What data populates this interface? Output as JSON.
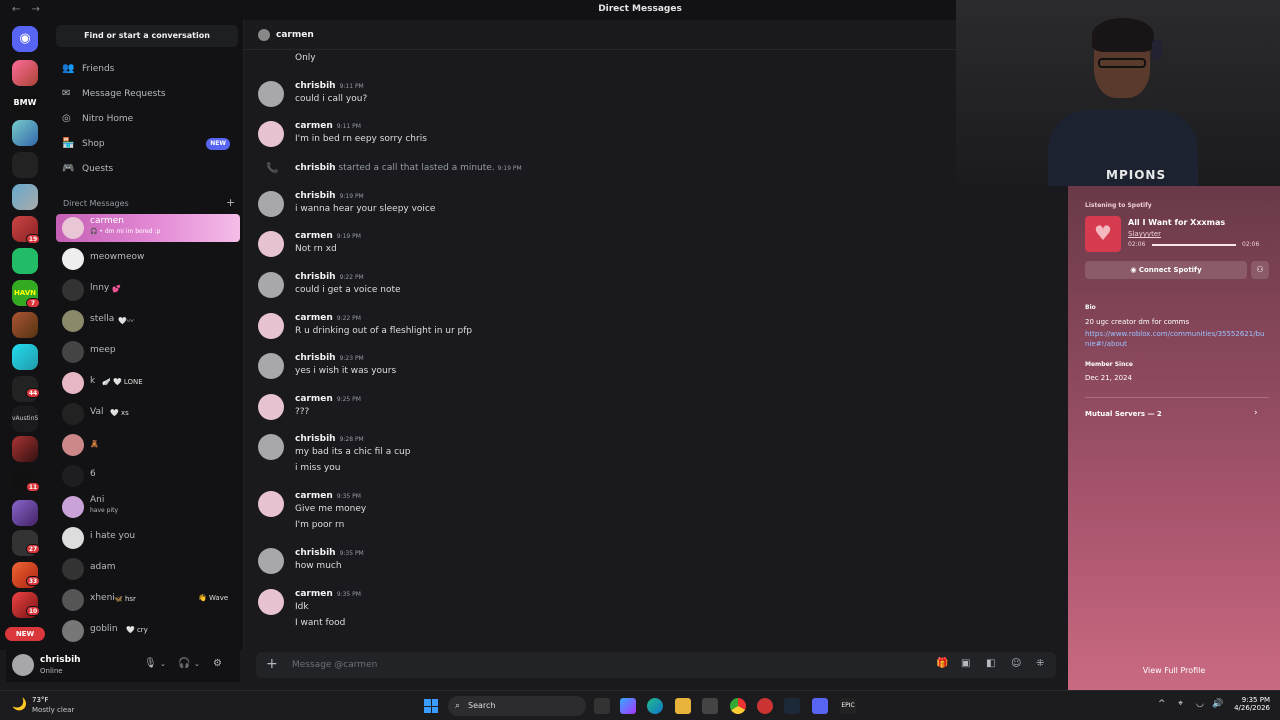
{
  "window": {
    "title": "Direct Messages",
    "nav": "← →"
  },
  "sidebar": {
    "find_label": "Find or start a conversation",
    "nav": [
      {
        "label": "Friends",
        "icon": "friends-icon",
        "glyph": "👥"
      },
      {
        "label": "Message Requests",
        "icon": "mail-icon",
        "glyph": "✉"
      },
      {
        "label": "Nitro Home",
        "icon": "nitro-icon",
        "glyph": "◎"
      },
      {
        "label": "Shop",
        "icon": "shop-icon",
        "glyph": "🏪",
        "badge": "NEW"
      },
      {
        "label": "Quests",
        "icon": "quests-icon",
        "glyph": "🎮"
      }
    ],
    "dm_header": "Direct Messages",
    "dms": [
      {
        "name": "carmen",
        "sub": "🎧 • dm mi im bored :p",
        "active": true
      },
      {
        "name": "meowmeow"
      },
      {
        "name": "lnny",
        "extra": "💕"
      },
      {
        "name": "stella",
        "extra": "🤍〰"
      },
      {
        "name": "meep"
      },
      {
        "name": "k",
        "extra": "🪽 🤍 LONE"
      },
      {
        "name": "Val",
        "extra": "🤍 xs"
      },
      {
        "name": "",
        "extra": "🧸"
      },
      {
        "name": "6"
      },
      {
        "name": "Ani",
        "sub": "have pity"
      },
      {
        "name": "i hate you"
      },
      {
        "name": "adam"
      },
      {
        "name": "xheni",
        "extra": "🦋 hsr",
        "wave": "👋 Wave"
      },
      {
        "name": "goblin",
        "extra": "🤍 cry"
      }
    ]
  },
  "rail": {
    "badges": [
      "19",
      "7",
      "44",
      "11",
      "27",
      "33",
      "10"
    ],
    "new_label": "NEW"
  },
  "user": {
    "name": "chrisbih",
    "status": "Online"
  },
  "chat": {
    "channel": "carmen",
    "first_line": "Only",
    "messages": [
      {
        "author": "chrisbih",
        "time": "9:11 PM",
        "lines": [
          "could i call you?"
        ]
      },
      {
        "author": "carmen",
        "time": "9:11 PM",
        "lines": [
          "I'm in bed rn eepy sorry chris"
        ]
      },
      {
        "author": "chrisbih",
        "time": "9:19 PM",
        "lines": [
          "i wanna hear your sleepy voice"
        ]
      },
      {
        "author": "carmen",
        "time": "9:19 PM",
        "lines": [
          "Not rn xd"
        ]
      },
      {
        "author": "chrisbih",
        "time": "9:22 PM",
        "lines": [
          "could i get a voice note"
        ]
      },
      {
        "author": "carmen",
        "time": "9:22 PM",
        "lines": [
          "R u drinking out of a fleshlight in ur pfp"
        ]
      },
      {
        "author": "chrisbih",
        "time": "9:23 PM",
        "lines": [
          "yes i wish it was yours"
        ]
      },
      {
        "author": "carmen",
        "time": "9:25 PM",
        "lines": [
          "???"
        ]
      },
      {
        "author": "chrisbih",
        "time": "9:28 PM",
        "lines": [
          "my bad its a chic fil a cup",
          "i miss you"
        ]
      },
      {
        "author": "carmen",
        "time": "9:35 PM",
        "lines": [
          "Give me money",
          "I'm poor rn"
        ]
      },
      {
        "author": "chrisbih",
        "time": "9:35 PM",
        "lines": [
          "how much"
        ]
      },
      {
        "author": "carmen",
        "time": "9:35 PM",
        "lines": [
          "Idk",
          "I want food"
        ]
      }
    ],
    "system": {
      "user": "chrisbih",
      "text": "started a call that lasted a minute.",
      "time": "9:19 PM"
    },
    "composer_placeholder": "Message @carmen"
  },
  "profile": {
    "spotify_label": "Listening to Spotify",
    "song": "All I Want for Xxxmas",
    "artist": "Slayyyter",
    "elapsed": "02:06",
    "duration": "02:06",
    "progress": 1.0,
    "connect_label": "Connect Spotify",
    "bio_label": "Bio",
    "bio": "20 ugc creator dm for comms",
    "bio_link": "https://www.roblox.com/communities/35552621/bunie#!/about",
    "member_since_label": "Member Since",
    "member_since": "Dec 21, 2024",
    "mutual_servers": "Mutual Servers — 2",
    "full_profile": "View Full Profile"
  },
  "webcam": {
    "shirt_text": "MPIONS"
  },
  "taskbar": {
    "temp": "73°F",
    "condition": "Mostly clear",
    "search": "Search",
    "time": "9:35 PM",
    "date": "4/26/2026"
  },
  "colors": {
    "accent": "#5865f2",
    "online": "#23a55a",
    "danger": "#da373c",
    "profile_bg": "#8e4a5e"
  }
}
